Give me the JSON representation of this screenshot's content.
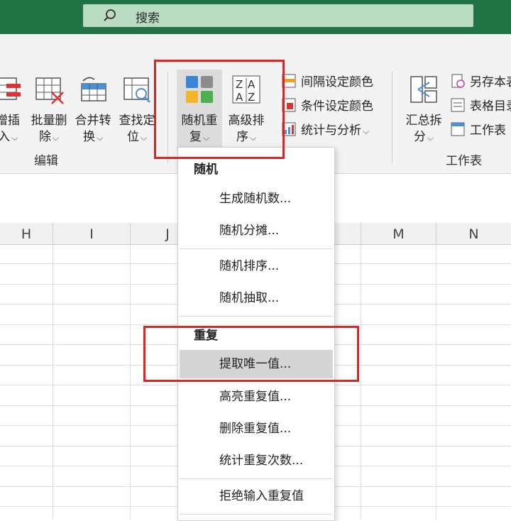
{
  "search": {
    "text": "搜索"
  },
  "ribbon": {
    "buttons": [
      {
        "line1": "增插",
        "line2": "入"
      },
      {
        "line1": "批量删",
        "line2": "除"
      },
      {
        "line1": "合并转",
        "line2": "换"
      },
      {
        "line1": "查找定",
        "line2": "位"
      },
      {
        "line1": "随机重",
        "line2": "复"
      },
      {
        "line1": "高级排",
        "line2": "序"
      },
      {
        "line1": "汇总拆",
        "line2": "分"
      }
    ],
    "small_buttons": [
      "间隔设定颜色",
      "条件设定颜色",
      "统计与分析",
      "另存本表",
      "表格目录",
      "工作表"
    ],
    "groups": {
      "edit": "编辑",
      "worksheet": "工作表"
    }
  },
  "columns": [
    "H",
    "I",
    "J",
    "M",
    "N"
  ],
  "menu": {
    "section_random": "随机",
    "section_repeat": "重复",
    "items": [
      "生成随机数...",
      "随机分摊...",
      "随机排序...",
      "随机抽取...",
      "提取唯一值...",
      "高亮重复值...",
      "删除重复值...",
      "统计重复次数...",
      "拒绝输入重复值"
    ]
  },
  "colors": {
    "titlebar": "#217346",
    "search_bg": "#b9dcc3",
    "annotation": "#e02424",
    "hover": "#d5d5d5"
  }
}
